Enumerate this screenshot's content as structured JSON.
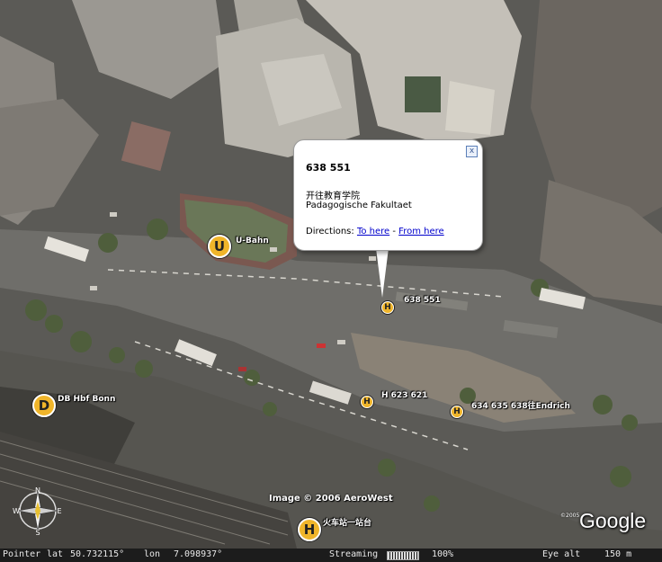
{
  "balloon": {
    "title": "638 551",
    "line_cn": "开往教育学院",
    "line_de": "Padagogische Fakultaet",
    "directions_label": "Directions:",
    "to_here": "To here",
    "separator": " - ",
    "from_here": "From here",
    "close_symbol": "x"
  },
  "labels": {
    "ubahn": "U-Bahn",
    "stop_638551": "638 551",
    "stop_h623621": "H 623 621",
    "stop_endrich": "634 635 638往Endrich",
    "db_bonn": "DB Hbf Bonn",
    "train_station": "火车站一站台"
  },
  "markers": {
    "u_symbol": "U",
    "h_symbol": "H",
    "d_symbol": "D"
  },
  "attribution": {
    "image_credit": "Image © 2006 AeroWest",
    "logo": "Google",
    "copyright_small": "©2005"
  },
  "compass": {
    "n": "N",
    "s": "S",
    "e": "E",
    "w": "W"
  },
  "status_bar": {
    "pointer_label": "Pointer",
    "lat_label": "lat",
    "lat_value": "50.732115°",
    "lon_label": "lon",
    "lon_value": "7.098937°",
    "streaming_label": "Streaming",
    "streaming_percent": "100%",
    "eye_alt_label": "Eye alt",
    "eye_alt_value": "150 m"
  }
}
